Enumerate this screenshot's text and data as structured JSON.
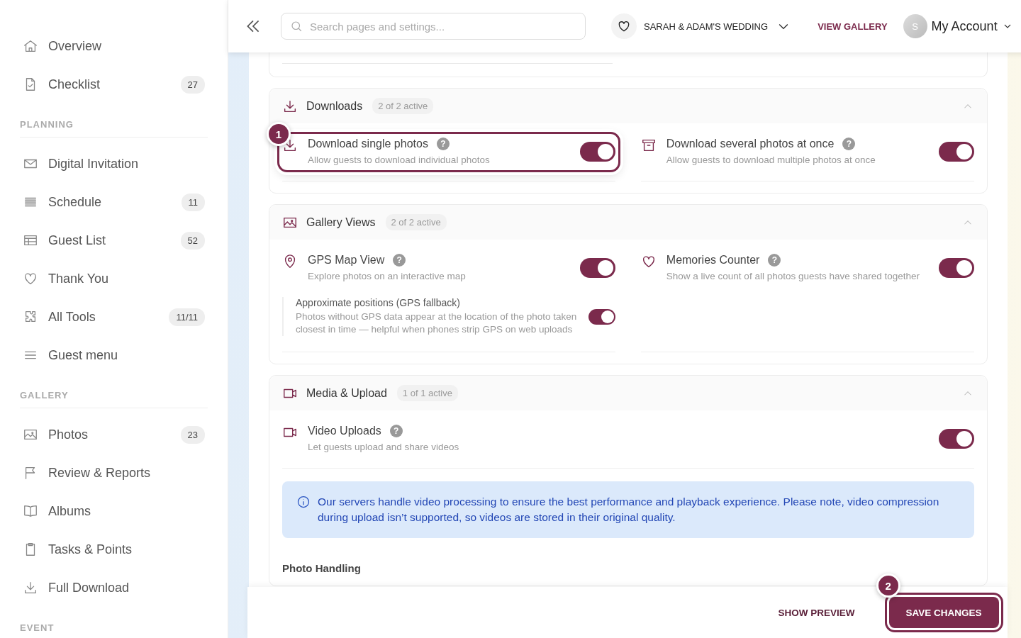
{
  "sidebar": {
    "groups": [
      {
        "items": [
          {
            "label": "Overview"
          },
          {
            "label": "Checklist",
            "count": "27"
          }
        ]
      },
      {
        "heading": "PLANNING",
        "items": [
          {
            "label": "Digital Invitation"
          },
          {
            "label": "Schedule",
            "count": "11"
          },
          {
            "label": "Guest List",
            "count": "52"
          },
          {
            "label": "Thank You"
          },
          {
            "label": "All Tools",
            "count": "11/11"
          },
          {
            "label": "Guest menu"
          }
        ]
      },
      {
        "heading": "GALLERY",
        "items": [
          {
            "label": "Photos",
            "count": "23"
          },
          {
            "label": "Review & Reports"
          },
          {
            "label": "Albums"
          },
          {
            "label": "Tasks & Points"
          },
          {
            "label": "Full Download"
          }
        ]
      },
      {
        "heading": "EVENT"
      }
    ]
  },
  "header": {
    "search": {
      "placeholder": "Search pages and settings..."
    },
    "event": "SARAH & ADAM'S WEDDING",
    "view_gallery": "VIEW GALLERY",
    "avatar": "S",
    "account": "My Account"
  },
  "sections": [
    {
      "title": "Downloads",
      "badge": "2 of 2 active",
      "expanded": true,
      "items": [
        {
          "title": "Download single photos",
          "help": "?",
          "description": "Allow guests to download individual photos",
          "on": true,
          "step": "1"
        },
        {
          "title": "Download several photos at once",
          "help": "?",
          "description": "Allow guests to download multiple photos at once",
          "on": true
        }
      ]
    },
    {
      "title": "Gallery Views",
      "badge": "2 of 2 active",
      "expanded": true,
      "items": [
        {
          "title": "GPS Map View",
          "help": "?",
          "description": "Explore photos on an interactive map",
          "on": true,
          "sub": {
            "title": "Approximate positions (GPS fallback)",
            "description": "Photos without GPS data appear at the location of the photo taken closest in time — helpful when phones strip GPS on web uploads",
            "on": true
          }
        },
        {
          "title": "Memories Counter",
          "help": "?",
          "description": "Show a live count of all photos guests have shared together",
          "on": true
        }
      ]
    },
    {
      "title": "Media & Upload",
      "badge": "1 of 1 active",
      "expanded": true,
      "items": [
        {
          "title": "Video Uploads",
          "help": "?",
          "description": "Let guests upload and share videos",
          "on": true
        }
      ],
      "notice": "Our servers handle video processing to ensure the best performance and playback experience. Please note, video compression during upload isn’t supported, so videos are stored in their original quality.",
      "subheading": "Photo Handling"
    }
  ],
  "footer": {
    "preview": "SHOW PREVIEW",
    "save": "SAVE CHANGES",
    "save_step": "2"
  }
}
